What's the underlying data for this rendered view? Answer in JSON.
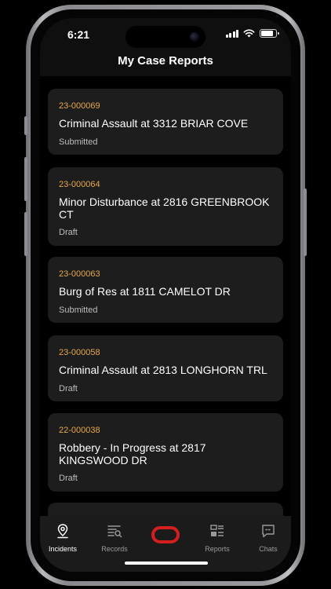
{
  "status_bar": {
    "time": "6:21"
  },
  "header": {
    "title": "My Case Reports"
  },
  "reports": [
    {
      "number": "23-000069",
      "title": "Criminal Assault at 3312 BRIAR COVE",
      "status": "Submitted"
    },
    {
      "number": "23-000064",
      "title": "Minor Disturbance at 2816 GREENBROOK CT",
      "status": "Draft"
    },
    {
      "number": "23-000063",
      "title": "Burg of Res at 1811 CAMELOT DR",
      "status": "Submitted"
    },
    {
      "number": "23-000058",
      "title": "Criminal Assault at 2813 LONGHORN TRL",
      "status": "Draft"
    },
    {
      "number": "22-000038",
      "title": "Robbery - In Progress at 2817 KINGSWOOD DR",
      "status": "Draft"
    }
  ],
  "tab_bar": {
    "active_tab": "Incidents",
    "tabs": [
      {
        "label": "Incidents",
        "icon": "location-pin-icon"
      },
      {
        "label": "Records",
        "icon": "records-search-icon"
      },
      {
        "label": "",
        "icon": "brand-logo-icon"
      },
      {
        "label": "Reports",
        "icon": "reports-grid-icon"
      },
      {
        "label": "Chats",
        "icon": "chat-bubble-icon"
      }
    ]
  },
  "colors": {
    "accent_case_number": "#e6a84b",
    "brand_logo": "#d51f1f",
    "card_background": "#1d1d1d"
  }
}
